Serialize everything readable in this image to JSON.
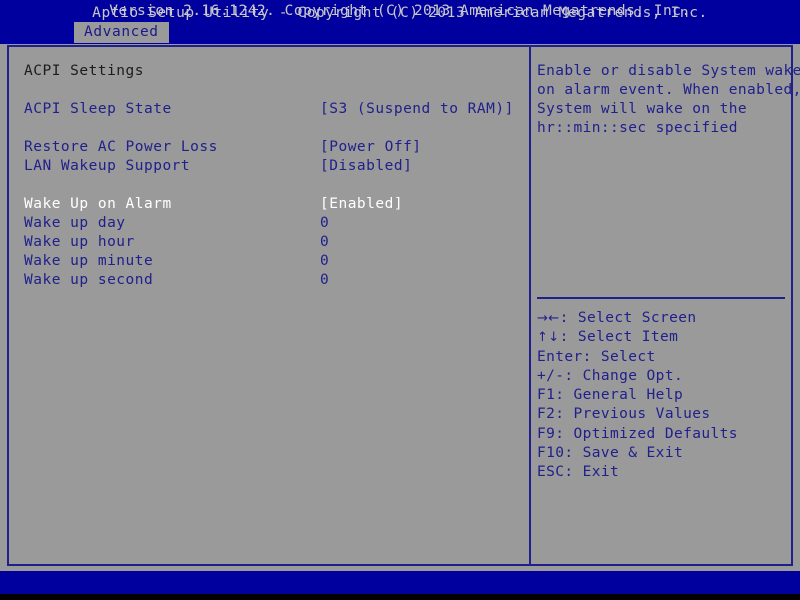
{
  "header": {
    "title": "Aptio Setup Utility - Copyright (C) 2013 American Megatrends, Inc.",
    "active_tab": "Advanced"
  },
  "main": {
    "section_title": "ACPI Settings",
    "options": [
      {
        "label": "ACPI Sleep State",
        "value": "[S3 (Suspend to RAM)]",
        "selected": false
      },
      {
        "label": "Restore AC Power Loss",
        "value": "[Power Off]",
        "selected": false
      },
      {
        "label": "LAN Wakeup Support",
        "value": "[Disabled]",
        "selected": false
      },
      {
        "label": "Wake Up on Alarm",
        "value": "[Enabled]",
        "selected": true
      },
      {
        "label": "Wake up day",
        "value": "0",
        "selected": false
      },
      {
        "label": "Wake up hour",
        "value": "0",
        "selected": false
      },
      {
        "label": "Wake up minute",
        "value": "0",
        "selected": false
      },
      {
        "label": "Wake up second",
        "value": "0",
        "selected": false
      }
    ]
  },
  "help": {
    "lines": [
      "Enable or disable System wake",
      "on alarm event. When enabled,",
      "System will wake on the",
      "hr::min::sec specified"
    ]
  },
  "keys": [
    {
      "glyph": "→←",
      "text": ": Select Screen"
    },
    {
      "glyph": "↑↓",
      "text": ": Select Item"
    },
    {
      "glyph": "",
      "text": "Enter: Select"
    },
    {
      "glyph": "",
      "text": "+/-: Change Opt."
    },
    {
      "glyph": "",
      "text": "F1: General Help"
    },
    {
      "glyph": "",
      "text": "F2: Previous Values"
    },
    {
      "glyph": "",
      "text": "F9: Optimized Defaults"
    },
    {
      "glyph": "",
      "text": "F10: Save & Exit"
    },
    {
      "glyph": "",
      "text": "ESC: Exit"
    }
  ],
  "footer": {
    "text": "Version 2.16.1242. Copyright (C) 2013 American Megatrends, Inc."
  },
  "colors": {
    "background": "#9a9a9a",
    "header_blue": "#00009f",
    "text_blue": "#20208c",
    "selected_white": "#ffffff",
    "title_black": "#1c1c1c",
    "header_text": "#c8c8c8"
  }
}
